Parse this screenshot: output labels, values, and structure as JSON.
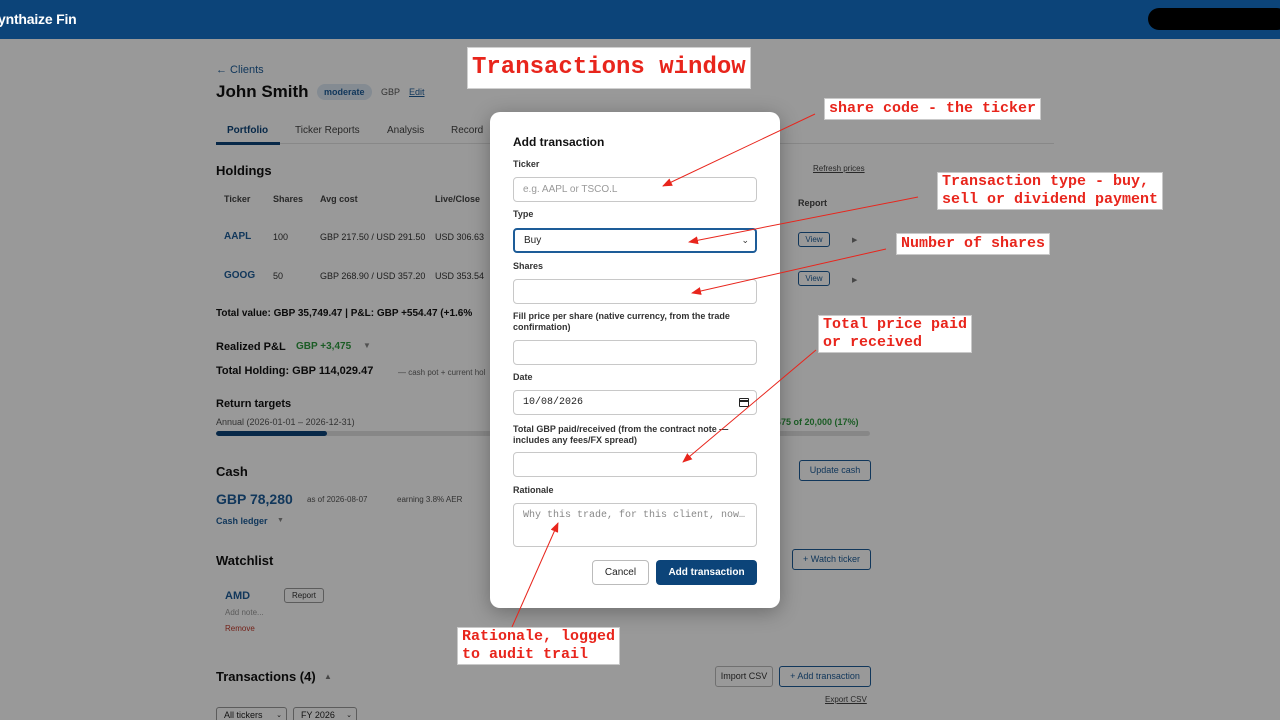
{
  "app": {
    "brand": "ynthaize Fin"
  },
  "client": {
    "back_link": "← Clients",
    "name": "John Smith",
    "risk_badge": "moderate",
    "currency": "GBP",
    "edit": "Edit"
  },
  "tabs": [
    {
      "label": "Portfolio",
      "active": true
    },
    {
      "label": "Ticker Reports"
    },
    {
      "label": "Analysis"
    },
    {
      "label": "Record"
    }
  ],
  "holdings": {
    "title": "Holdings",
    "refresh": "Refresh prices",
    "columns": [
      "Ticker",
      "Shares",
      "Avg cost",
      "Live/Close"
    ],
    "report_column": "Report",
    "rows": [
      {
        "ticker": "AAPL",
        "shares": "100",
        "avg_cost": "GBP 217.50 / USD 291.50",
        "live": "USD 306.63",
        "report": "View"
      },
      {
        "ticker": "GOOG",
        "shares": "50",
        "avg_cost": "GBP 268.90 / USD 357.20",
        "live": "USD 353.54",
        "report": "View"
      }
    ],
    "totals": "Total value: GBP 35,749.47 | P&L: GBP +554.47 (+1.6%"
  },
  "realized": {
    "label": "Realized P&L",
    "value": "GBP +3,475",
    "caret": "▼"
  },
  "total_holding": {
    "label": "Total Holding: GBP 114,029.47",
    "note": "— cash pot + current hol"
  },
  "return_targets": {
    "title": "Return targets",
    "annual": "Annual (2026-01-01 – 2026-12-31)",
    "progress_text": "475 of 20,000 (17%)",
    "progress_fraction": 0.17
  },
  "cash": {
    "title": "Cash",
    "value": "GBP 78,280",
    "as_of": "as of 2026-08-07",
    "earning": "earning 3.8% AER",
    "ledger": "Cash ledger",
    "ledger_caret": "▼",
    "update_button": "Update cash"
  },
  "watchlist": {
    "title": "Watchlist",
    "watch_button": "+ Watch ticker",
    "items": [
      {
        "ticker": "AMD",
        "report": "Report",
        "note_placeholder": "Add note...",
        "remove": "Remove"
      }
    ]
  },
  "transactions": {
    "title": "Transactions (4)",
    "caret": "▲",
    "import": "Import CSV",
    "add": "+ Add transaction",
    "export": "Export CSV",
    "filter_ticker": "All tickers",
    "filter_year": "FY 2026"
  },
  "modal": {
    "title": "Add transaction",
    "ticker_label": "Ticker",
    "ticker_placeholder": "e.g. AAPL or TSCO.L",
    "type_label": "Type",
    "type_value": "Buy",
    "shares_label": "Shares",
    "fill_price_label": "Fill price per share (native currency, from the trade confirmation)",
    "date_label": "Date",
    "date_value": "10/08/2026",
    "total_label": "Total GBP paid/received (from the contract note — includes any fees/FX spread)",
    "rationale_label": "Rationale",
    "rationale_placeholder": "Why this trade, for this client, now…",
    "cancel": "Cancel",
    "submit": "Add transaction"
  },
  "annotations": {
    "title": "Transactions window",
    "share_code": "share code - the ticker",
    "tx_type": "Transaction type - buy,\nsell or dividend payment",
    "num_shares": "Number of shares",
    "total_price": "Total price paid\nor received",
    "rationale": "Rationale, logged\nto audit trail"
  },
  "colors": {
    "topbar": "#0c4479",
    "accent": "#1d5c98",
    "positive": "#2e9a3f",
    "danger": "#c0392b",
    "annotation": "#e8251c"
  }
}
